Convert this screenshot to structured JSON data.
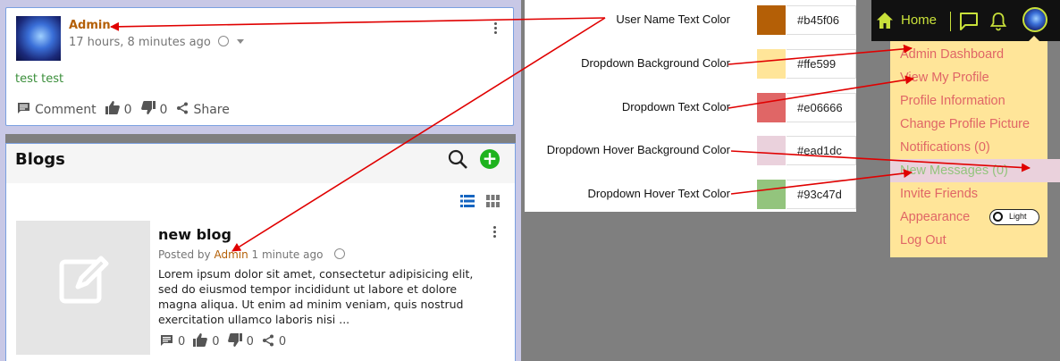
{
  "post": {
    "author": "Admin",
    "time": "17 hours, 8 minutes ago",
    "text": "test test",
    "actions": {
      "comment": "Comment",
      "likes": "0",
      "dislikes": "0",
      "share": "Share"
    }
  },
  "blogs": {
    "title": "Blogs",
    "item": {
      "title": "new blog",
      "posted_by": "Posted by",
      "author": "Admin",
      "time": "1 minute ago",
      "excerpt": "Lorem ipsum dolor sit amet, consectetur adipisicing elit, sed do eiusmod tempor incididunt ut labore et dolore magna aliqua. Ut enim ad minim veniam, quis nostrud exercitation ullamco laboris nisi ...",
      "comments": "0",
      "likes": "0",
      "dislikes": "0",
      "shares": "0"
    }
  },
  "color_settings": [
    {
      "label": "User Name Text Color",
      "hex": "#b45f06"
    },
    {
      "label": "Dropdown Background Color",
      "hex": "#ffe599"
    },
    {
      "label": "Dropdown Text Color",
      "hex": "#e06666"
    },
    {
      "label": "Dropdown Hover Background Color",
      "hex": "#ead1dc"
    },
    {
      "label": "Dropdown Hover Text Color",
      "hex": "#93c47d"
    }
  ],
  "navbar": {
    "home": "Home"
  },
  "dropdown": {
    "items": [
      "Admin Dashboard",
      "View My Profile",
      "Profile Information",
      "Change Profile Picture",
      "Notifications (0)",
      "New Messages (0)",
      "Invite Friends",
      "Appearance",
      "Log Out"
    ],
    "appearance_toggle": "Light"
  },
  "colors": {
    "username": "#b45f06",
    "dropdown_bg": "#ffe599",
    "dropdown_text": "#e06666",
    "dropdown_hover_bg": "#ead1dc",
    "dropdown_hover_text": "#93c47d",
    "nav_accent": "#c8e03a",
    "annotation_arrow": "#e00000"
  }
}
